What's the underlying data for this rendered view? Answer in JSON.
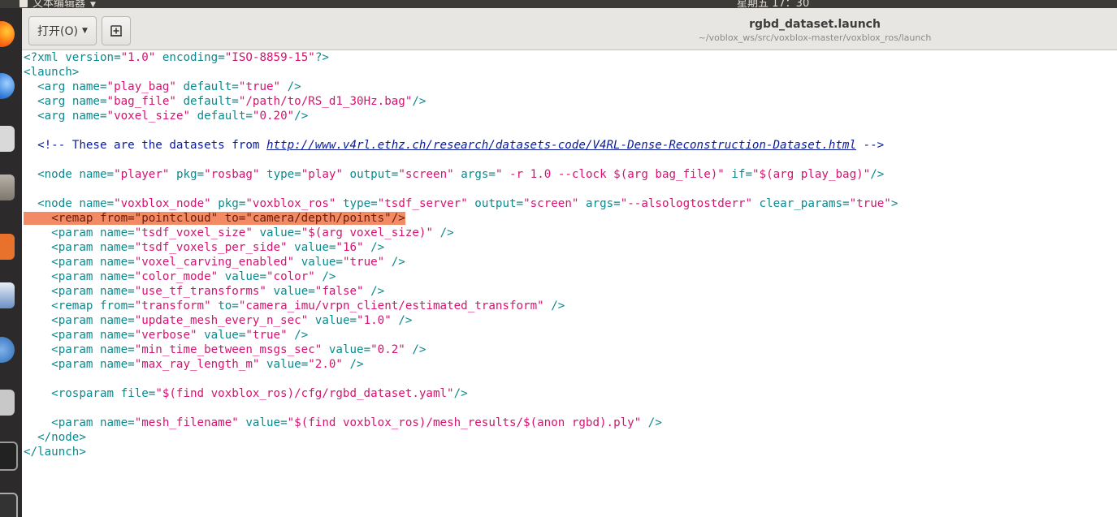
{
  "top_panel": {
    "app_name": "文本编辑器",
    "clock": "星期五 17：30"
  },
  "header": {
    "open_label": "打开(O)",
    "title": "rgbd_dataset.launch",
    "path": "~/voblox_ws/src/voxblox-master/voxblox_ros/launch"
  },
  "editor": {
    "lines": [
      "<?xml version=\"1.0\" encoding=\"ISO-8859-15\"?>",
      "<launch>",
      "  <arg name=\"play_bag\" default=\"true\" />",
      "  <arg name=\"bag_file\" default=\"/path/to/RS_d1_30Hz.bag\"/>",
      "  <arg name=\"voxel_size\" default=\"0.20\"/>",
      "",
      "  <!-- These are the datasets from http://www.v4rl.ethz.ch/research/datasets-code/V4RL-Dense-Reconstruction-Dataset.html -->",
      "",
      "  <node name=\"player\" pkg=\"rosbag\" type=\"play\" output=\"screen\" args=\" -r 1.0 --clock $(arg bag_file)\" if=\"$(arg play_bag)\"/>",
      "",
      "  <node name=\"voxblox_node\" pkg=\"voxblox_ros\" type=\"tsdf_server\" output=\"screen\" args=\"--alsologtostderr\" clear_params=\"true\">",
      "    <remap from=\"pointcloud\" to=\"camera/depth/points\"/>",
      "    <param name=\"tsdf_voxel_size\" value=\"$(arg voxel_size)\" />",
      "    <param name=\"tsdf_voxels_per_side\" value=\"16\" />",
      "    <param name=\"voxel_carving_enabled\" value=\"true\" />",
      "    <param name=\"color_mode\" value=\"color\" />",
      "    <param name=\"use_tf_transforms\" value=\"false\" />",
      "    <remap from=\"transform\" to=\"camera_imu/vrpn_client/estimated_transform\" />",
      "    <param name=\"update_mesh_every_n_sec\" value=\"1.0\" />",
      "    <param name=\"verbose\" value=\"true\" />",
      "    <param name=\"min_time_between_msgs_sec\" value=\"0.2\" />",
      "    <param name=\"max_ray_length_m\" value=\"2.0\" />",
      "",
      "    <rosparam file=\"$(find voxblox_ros)/cfg/rgbd_dataset.yaml\"/>",
      "",
      "    <param name=\"mesh_filename\" value=\"$(find voxblox_ros)/mesh_results/$(anon rgbd).ply\" />",
      "  </node>",
      "</launch>"
    ],
    "highlighted_line": 11
  },
  "colors": {
    "tag": "#0b8a8e",
    "value": "#d4146f",
    "comment": "#0a1a9c",
    "highlight": "#f28b63"
  }
}
